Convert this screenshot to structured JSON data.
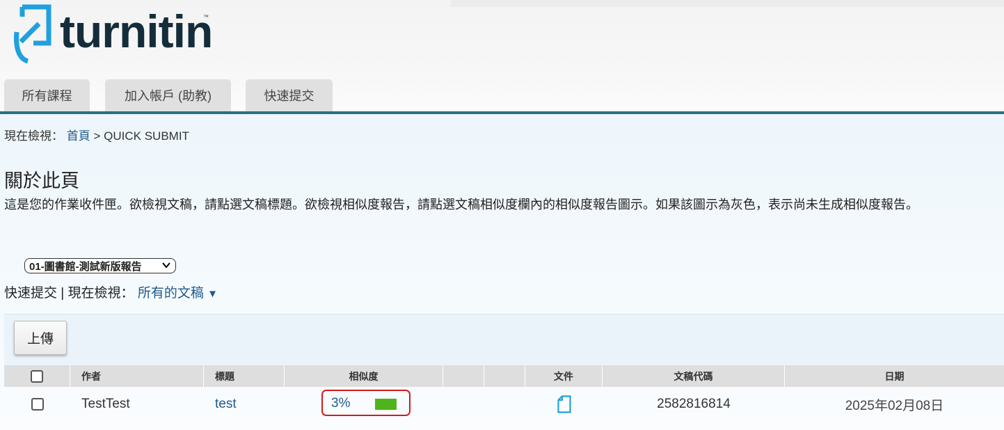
{
  "brand": {
    "name": "turnitin",
    "tm": "™"
  },
  "tabs": [
    {
      "label": "所有課程"
    },
    {
      "label": "加入帳戶 (助教)"
    },
    {
      "label": "快速提交"
    }
  ],
  "breadcrumb": {
    "prefix": "現在檢視：",
    "home": "首頁",
    "separator": ">",
    "current": "QUICK SUBMIT"
  },
  "about": {
    "title": "關於此頁",
    "description": "這是您的作業收件匣。欲檢視文稿，請點選文稿標題。欲檢視相似度報告，請點選文稿相似度欄內的相似度報告圖示。如果該圖示為灰色，表示尚未生成相似度報告。"
  },
  "folder_select": {
    "value": "01-圖書館-測試新版報告"
  },
  "viewing": {
    "section": "快速提交",
    "separator": "|",
    "prefix": "現在檢視：",
    "filter": "所有的文稿",
    "arrow": "▼"
  },
  "toolbar": {
    "upload_label": "上傳"
  },
  "table": {
    "headers": {
      "author": "作者",
      "title": "標題",
      "similarity": "相似度",
      "file": "文件",
      "paper_id": "文稿代碼",
      "date": "日期"
    },
    "rows": [
      {
        "author": "TestTest",
        "title": "test",
        "similarity": "3%",
        "similarity_value": 3,
        "file_icon": "document-icon",
        "paper_id": "2582816814",
        "date": "2025年02月08日"
      }
    ]
  },
  "colors": {
    "brand_dark": "#152d3a",
    "brand_blue": "#1fa0e0",
    "link": "#1f5a8c",
    "similarity_bar": "#4fb31b",
    "highlight_border": "#d01c1c"
  }
}
